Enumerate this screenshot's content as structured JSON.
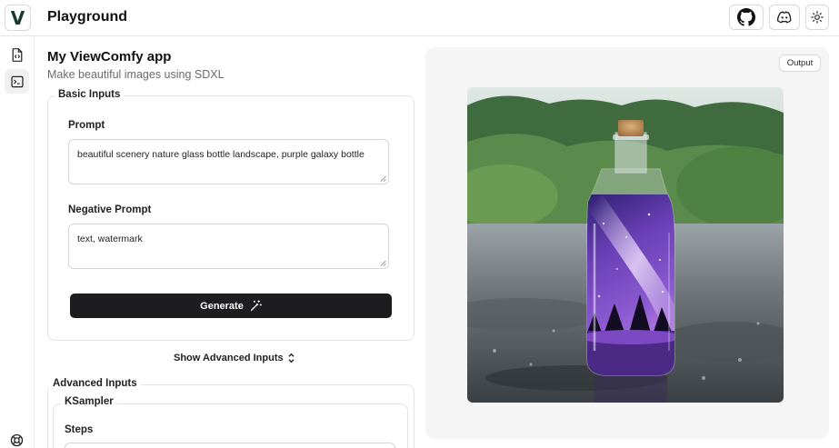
{
  "header": {
    "logo_letter": "V",
    "title": "Playground",
    "github_icon": "github-icon",
    "discord_icon": "discord-icon",
    "theme_icon": "sun-icon"
  },
  "sidebar": {
    "items": [
      {
        "icon": "file-code-icon",
        "active": false
      },
      {
        "icon": "terminal-icon",
        "active": true
      },
      {
        "icon": "help-lifebuoy-icon",
        "active": false
      }
    ]
  },
  "app": {
    "title": "My ViewComfy app",
    "subtitle": "Make beautiful images using SDXL"
  },
  "basic_inputs": {
    "legend": "Basic Inputs",
    "prompt_label": "Prompt",
    "prompt_value": "beautiful scenery nature glass bottle landscape, purple galaxy bottle",
    "negative_label": "Negative Prompt",
    "negative_value": "text, watermark",
    "generate_label": "Generate"
  },
  "advanced_toggle": {
    "label": "Show Advanced Inputs"
  },
  "advanced_inputs": {
    "legend": "Advanced Inputs",
    "ksampler_legend": "KSampler",
    "steps_label": "Steps"
  },
  "output": {
    "badge": "Output",
    "image_subject": "glass bottle with purple galaxy scene on wet stone near forest"
  },
  "colors": {
    "button_dark": "#1d1d1f",
    "border": "#e4e4e4",
    "output_bg": "#f5f5f5",
    "galaxy_purple": "#6a3fb5"
  }
}
